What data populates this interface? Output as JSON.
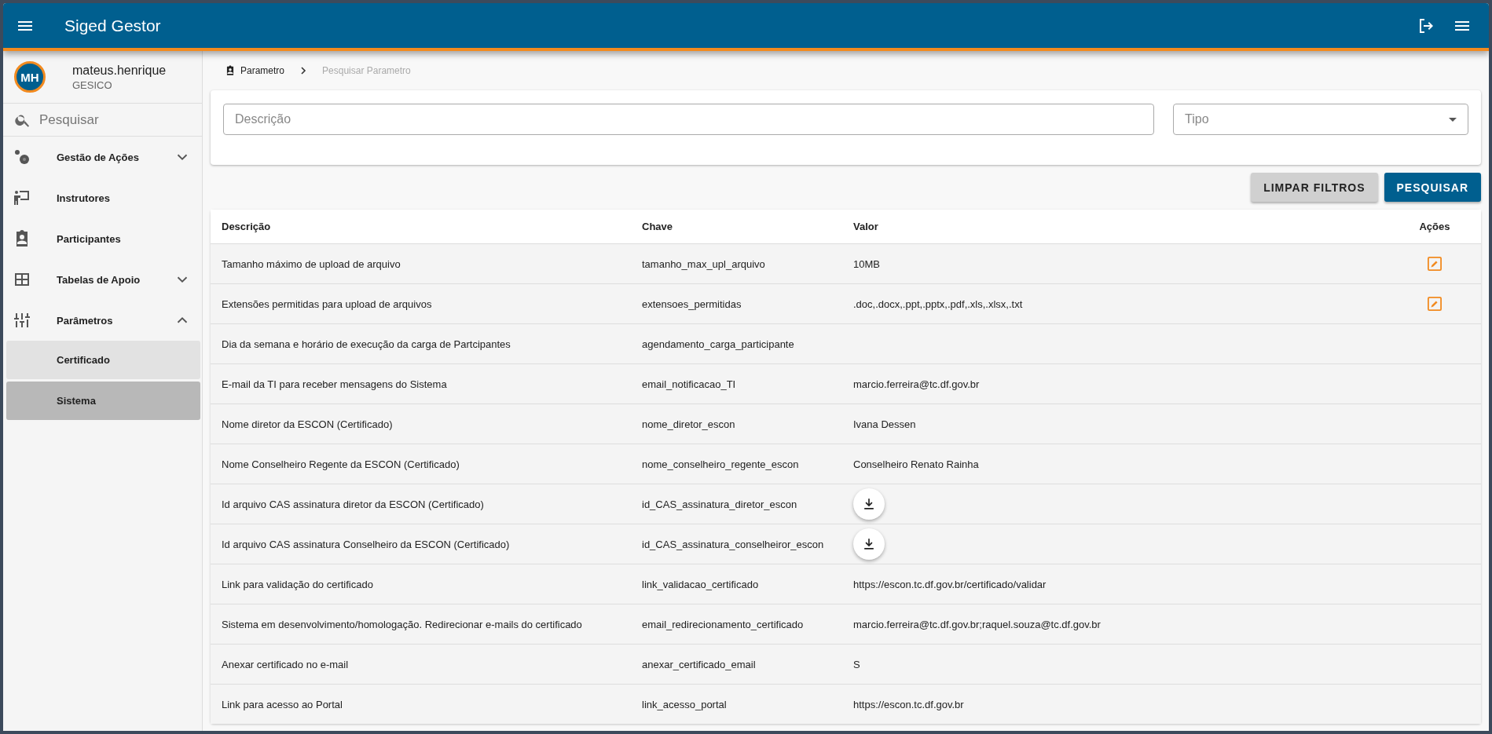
{
  "app_bar": {
    "title": "Siged Gestor"
  },
  "user": {
    "initials": "MH",
    "name": "mateus.henrique",
    "organization": "GESICO"
  },
  "sidebar": {
    "search": {
      "placeholder": "Pesquisar"
    },
    "items": [
      {
        "label": "Gestão de Ações",
        "expanded": false
      },
      {
        "label": "Instrutores"
      },
      {
        "label": "Participantes"
      },
      {
        "label": "Tabelas de Apoio",
        "expanded": false
      },
      {
        "label": "Parâmetros",
        "expanded": true,
        "children": [
          {
            "label": "Certificado",
            "selected": false
          },
          {
            "label": "Sistema",
            "selected": true
          }
        ]
      }
    ]
  },
  "breadcrumb": [
    {
      "label": "Parametro",
      "current": false
    },
    {
      "label": "Pesquisar Parametro",
      "current": true
    }
  ],
  "filters": {
    "description": {
      "placeholder": "Descrição"
    },
    "type": {
      "placeholder": "Tipo"
    }
  },
  "buttons": [
    {
      "label": "LIMPAR FILTROS",
      "kind": "secondary"
    },
    {
      "label": "PESQUISAR",
      "kind": "primary"
    }
  ],
  "table": {
    "columns": [
      "Descrição",
      "Chave",
      "Valor",
      "Ações"
    ],
    "rows": [
      {
        "description": "Tamanho máximo de upload de arquivo",
        "key": "tamanho_max_upl_arquivo",
        "kind": "text",
        "value": "10MB",
        "editable": true
      },
      {
        "description": "Extensões permitidas para upload de arquivos",
        "key": "extensoes_permitidas",
        "kind": "text",
        "value": ".doc,.docx,.ppt,.pptx,.pdf,.xls,.xlsx,.txt",
        "editable": true
      },
      {
        "description": "Dia da semana e horário de execução da carga de Partcipantes",
        "key": "agendamento_carga_participante",
        "kind": "text",
        "editable": false
      },
      {
        "description": "E-mail da TI para receber mensagens do Sistema",
        "key": "email_notificacao_TI",
        "kind": "text",
        "value": "marcio.ferreira@tc.df.gov.br",
        "editable": false
      },
      {
        "description": "Nome diretor da ESCON (Certificado)",
        "key": "nome_diretor_escon",
        "kind": "text",
        "value": "Ivana Dessen",
        "editable": false
      },
      {
        "description": "Nome Conselheiro Regente da ESCON (Certificado)",
        "key": "nome_conselheiro_regente_escon",
        "kind": "text",
        "value": "Conselheiro Renato Rainha",
        "editable": false
      },
      {
        "description": "Id arquivo CAS assinatura diretor da ESCON (Certificado)",
        "key": "id_CAS_assinatura_diretor_escon",
        "kind": "download",
        "editable": false
      },
      {
        "description": "Id arquivo CAS assinatura Conselheiro da ESCON (Certificado)",
        "key": "id_CAS_assinatura_conselheiror_escon",
        "kind": "download",
        "editable": false
      },
      {
        "description": "Link para validação do certificado",
        "key": "link_validacao_certificado",
        "kind": "text",
        "value": "https://escon.tc.df.gov.br/certificado/validar",
        "editable": false
      },
      {
        "description": "Sistema em desenvolvimento/homologação. Redirecionar e-mails do certificado",
        "key": "email_redirecionamento_certificado",
        "kind": "text",
        "value": "marcio.ferreira@tc.df.gov.br;raquel.souza@tc.df.gov.br",
        "editable": false
      },
      {
        "description": "Anexar certificado no e-mail",
        "key": "anexar_certificado_email",
        "kind": "text",
        "value": "S",
        "editable": false
      },
      {
        "description": "Link para acesso ao Portal",
        "key": "link_acesso_portal",
        "kind": "text",
        "value": "https://escon.tc.df.gov.br",
        "editable": false
      }
    ]
  }
}
